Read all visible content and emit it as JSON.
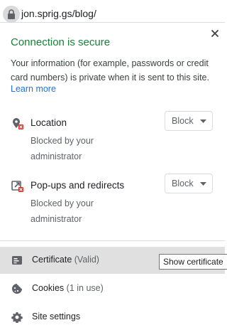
{
  "omnibox": {
    "url": "jon.sprig.gs/blog/",
    "lock_icon": "lock-icon"
  },
  "panel": {
    "close_icon": "close-icon",
    "title": "Connection is secure",
    "description": "Your information (for example, passwords or credit card numbers) is private when it is sent to this site.",
    "learn_more": "Learn more",
    "title_color": "#188038",
    "link_color": "#1a73e8"
  },
  "permissions": [
    {
      "icon": "location-blocked-icon",
      "label": "Location",
      "sublabel": "Blocked by your administrator",
      "value": "Block"
    },
    {
      "icon": "popups-blocked-icon",
      "label": "Pop-ups and redirects",
      "sublabel": "Blocked by your administrator",
      "value": "Block"
    }
  ],
  "rows": {
    "certificate": {
      "icon": "certificate-icon",
      "label": "Certificate",
      "status": "(Valid)"
    },
    "cookies": {
      "icon": "cookie-icon",
      "label": "Cookies",
      "status": "(1 in use)"
    },
    "site_settings": {
      "icon": "gear-icon",
      "label": "Site settings"
    }
  },
  "tooltip": {
    "text": "Show certificate"
  }
}
